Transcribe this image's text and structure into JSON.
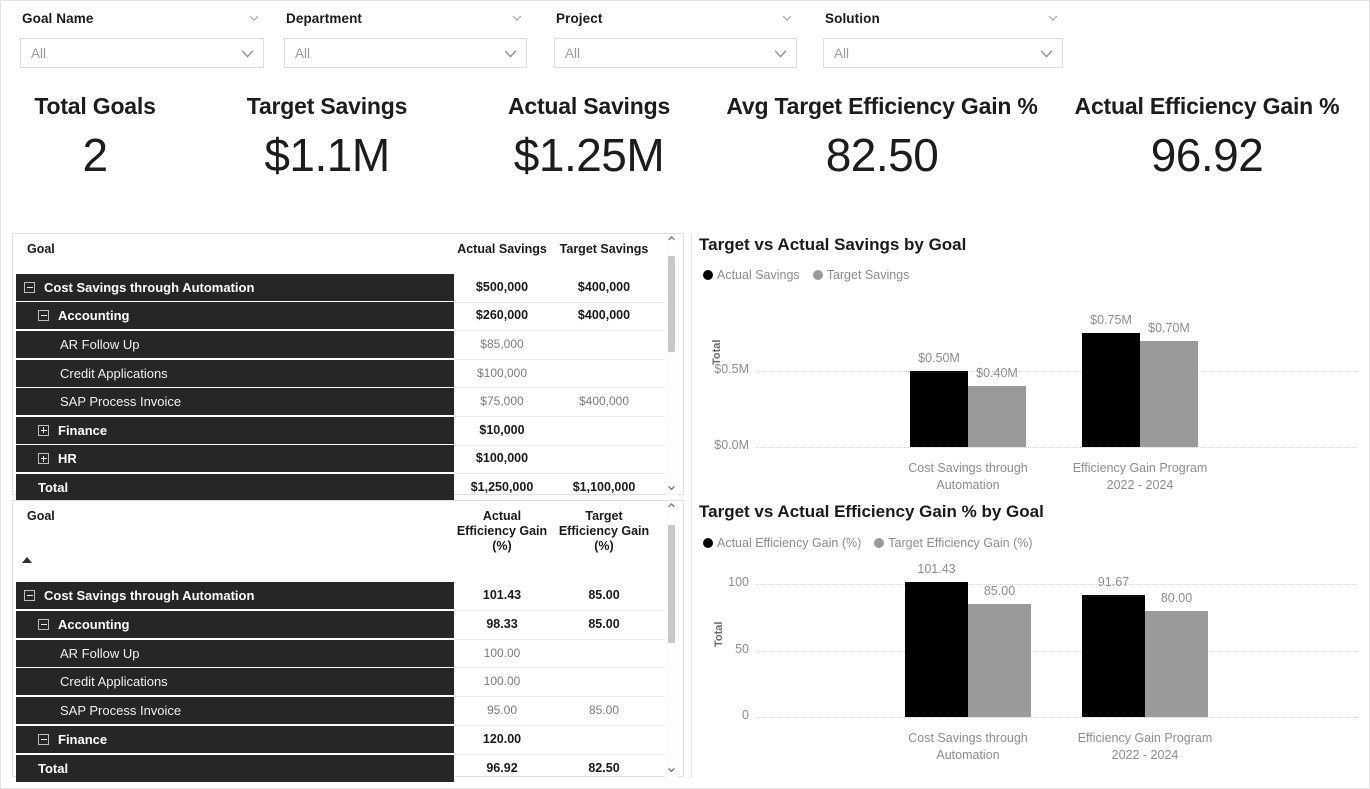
{
  "slicers": [
    {
      "title": "Goal Name",
      "value": "All",
      "chevron_icon": "chevron-down-icon"
    },
    {
      "title": "Department",
      "value": "All",
      "chevron_icon": "chevron-down-icon"
    },
    {
      "title": "Project",
      "value": "All",
      "chevron_icon": "chevron-down-icon"
    },
    {
      "title": "Solution",
      "value": "All",
      "chevron_icon": "chevron-down-icon"
    }
  ],
  "kpis": [
    {
      "label": "Total Goals",
      "value": "2"
    },
    {
      "label": "Target Savings",
      "value": "$1.1M"
    },
    {
      "label": "Actual Savings",
      "value": "$1.25M"
    },
    {
      "label": "Avg Target Efficiency Gain %",
      "value": "82.50"
    },
    {
      "label": "Actual Efficiency Gain %",
      "value": "96.92"
    }
  ],
  "savings_matrix": {
    "row_header": "Goal",
    "columns": [
      "Actual Savings",
      "Target Savings"
    ],
    "rows": [
      {
        "label": "Cost Savings through Automation",
        "level": 0,
        "state": "expanded",
        "actual": "$500,000",
        "target": "$400,000",
        "emphasis": "bold"
      },
      {
        "label": "Accounting",
        "level": 1,
        "state": "expanded",
        "actual": "$260,000",
        "target": "$400,000",
        "emphasis": "bold"
      },
      {
        "label": "AR Follow Up",
        "level": 2,
        "state": "leaf",
        "actual": "$85,000",
        "target": "",
        "emphasis": "dim"
      },
      {
        "label": "Credit Applications",
        "level": 2,
        "state": "leaf",
        "actual": "$100,000",
        "target": "",
        "emphasis": "dim"
      },
      {
        "label": "SAP Process Invoice",
        "level": 2,
        "state": "leaf",
        "actual": "$75,000",
        "target": "$400,000",
        "emphasis": "dim"
      },
      {
        "label": "Finance",
        "level": 1,
        "state": "collapsed",
        "actual": "$10,000",
        "target": "",
        "emphasis": "bold"
      },
      {
        "label": "HR",
        "level": 1,
        "state": "collapsed",
        "actual": "$100,000",
        "target": "",
        "emphasis": "bold"
      },
      {
        "label": "Total",
        "level": 1,
        "state": "total",
        "actual": "$1,250,000",
        "target": "$1,100,000",
        "emphasis": "bold"
      }
    ]
  },
  "efficiency_matrix": {
    "row_header": "Goal",
    "columns": [
      "Actual Efficiency Gain (%)",
      "Target Efficiency Gain (%)"
    ],
    "column_lines": [
      [
        "Actual",
        "Efficiency Gain",
        "(%)"
      ],
      [
        "Target",
        "Efficiency Gain",
        "(%)"
      ]
    ],
    "sort_indicator": "sort-ascending-icon",
    "rows": [
      {
        "label": "Cost Savings through Automation",
        "level": 0,
        "state": "expanded",
        "actual": "101.43",
        "target": "85.00",
        "emphasis": "bold"
      },
      {
        "label": "Accounting",
        "level": 1,
        "state": "expanded",
        "actual": "98.33",
        "target": "85.00",
        "emphasis": "bold"
      },
      {
        "label": "AR Follow Up",
        "level": 2,
        "state": "leaf",
        "actual": "100.00",
        "target": "",
        "emphasis": "dim"
      },
      {
        "label": "Credit Applications",
        "level": 2,
        "state": "leaf",
        "actual": "100.00",
        "target": "",
        "emphasis": "dim"
      },
      {
        "label": "SAP Process Invoice",
        "level": 2,
        "state": "leaf",
        "actual": "95.00",
        "target": "85.00",
        "emphasis": "dim"
      },
      {
        "label": "Finance",
        "level": 1,
        "state": "expanded",
        "actual": "120.00",
        "target": "",
        "emphasis": "bold"
      },
      {
        "label": "Total",
        "level": 1,
        "state": "total",
        "actual": "96.92",
        "target": "82.50",
        "emphasis": "bold"
      }
    ]
  },
  "chart_data": [
    {
      "type": "bar",
      "title": "Target vs Actual Savings by Goal",
      "categories": [
        "Cost Savings through Automation",
        "Efficiency Gain Program 2022 - 2024"
      ],
      "category_lines": [
        [
          "Cost Savings through",
          "Automation"
        ],
        [
          "Efficiency Gain Program",
          "2022 - 2024"
        ]
      ],
      "series": [
        {
          "name": "Actual Savings",
          "color": "#000000",
          "values": [
            500000,
            750000
          ],
          "labels": [
            "$0.50M",
            "$0.75M"
          ]
        },
        {
          "name": "Target Savings",
          "color": "#9a9a9a",
          "values": [
            400000,
            700000
          ],
          "labels": [
            "$0.40M",
            "$0.70M"
          ]
        }
      ],
      "xlabel": "",
      "ylabel": "Total",
      "ylim": [
        0,
        1000000
      ],
      "yticks": [
        0,
        500000
      ],
      "ytick_labels": [
        "$0.0M",
        "$0.5M"
      ],
      "grid": true,
      "legend_position": "top-left"
    },
    {
      "type": "bar",
      "title": "Target vs Actual Efficiency Gain % by Goal",
      "categories": [
        "Cost Savings through Automation",
        "Efficiency Gain Program 2022 - 2024"
      ],
      "category_lines": [
        [
          "Cost Savings through",
          "Automation"
        ],
        [
          "Efficiency Gain Program",
          "2022 - 2024"
        ]
      ],
      "series": [
        {
          "name": "Actual Efficiency Gain (%)",
          "color": "#000000",
          "values": [
            101.43,
            91.67
          ],
          "labels": [
            "101.43",
            "91.67"
          ]
        },
        {
          "name": "Target Efficiency Gain (%)",
          "color": "#9a9a9a",
          "values": [
            85.0,
            80.0
          ],
          "labels": [
            "85.00",
            "80.00"
          ]
        }
      ],
      "xlabel": "",
      "ylabel": "Total",
      "ylim": [
        0,
        110
      ],
      "yticks": [
        0,
        50,
        100
      ],
      "ytick_labels": [
        "0",
        "50",
        "100"
      ],
      "grid": true,
      "legend_position": "top-left"
    }
  ],
  "theme": {
    "row_band": "#262626",
    "series_actual": "#000000",
    "series_target": "#9a9a9a",
    "text_dark": "#1a1a1a",
    "text_muted": "#8d8d8d"
  }
}
